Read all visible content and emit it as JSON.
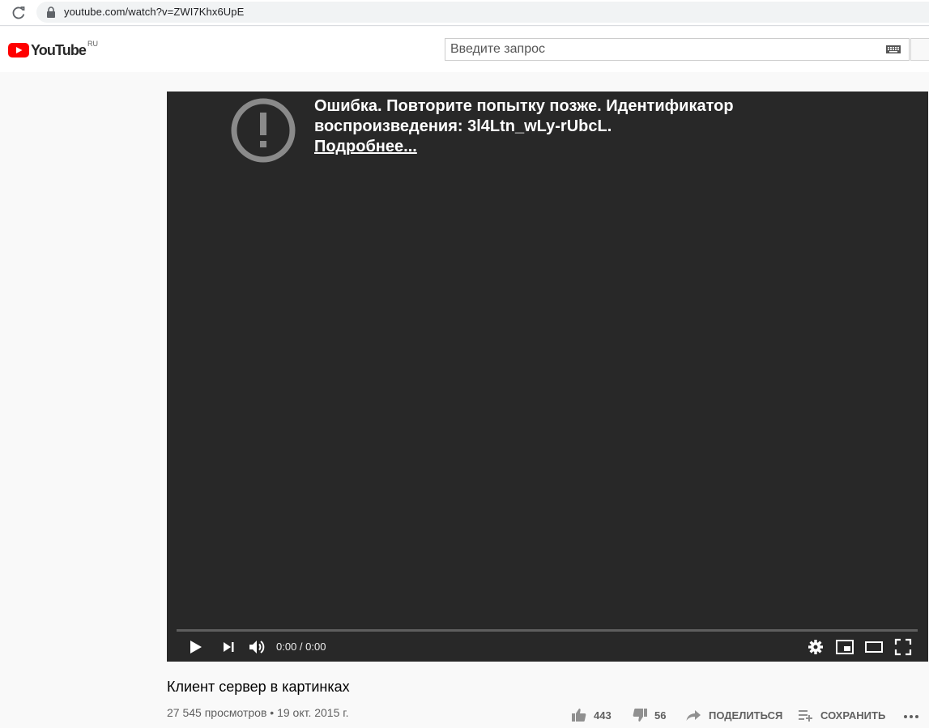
{
  "browser": {
    "url": "youtube.com/watch?v=ZWI7Khx6UpE"
  },
  "header": {
    "logo_text": "YouTube",
    "region": "RU",
    "search_placeholder": "Введите запрос"
  },
  "player": {
    "error_line1": "Ошибка. Повторите попытку позже. Идентификатор",
    "error_line2": "воспроизведения: 3l4Ltn_wLy-rUbcL.",
    "error_link": "Подробнее...",
    "time": "0:00 / 0:00"
  },
  "video": {
    "title": "Клиент сервер в картинках",
    "views_date": "27 545 просмотров • 19 окт. 2015 г.",
    "likes": "443",
    "dislikes": "56",
    "share_label": "ПОДЕЛИТЬСЯ",
    "save_label": "СОХРАНИТЬ"
  },
  "colors": {
    "brand_red": "#ff0000",
    "player_bg": "#282828"
  }
}
